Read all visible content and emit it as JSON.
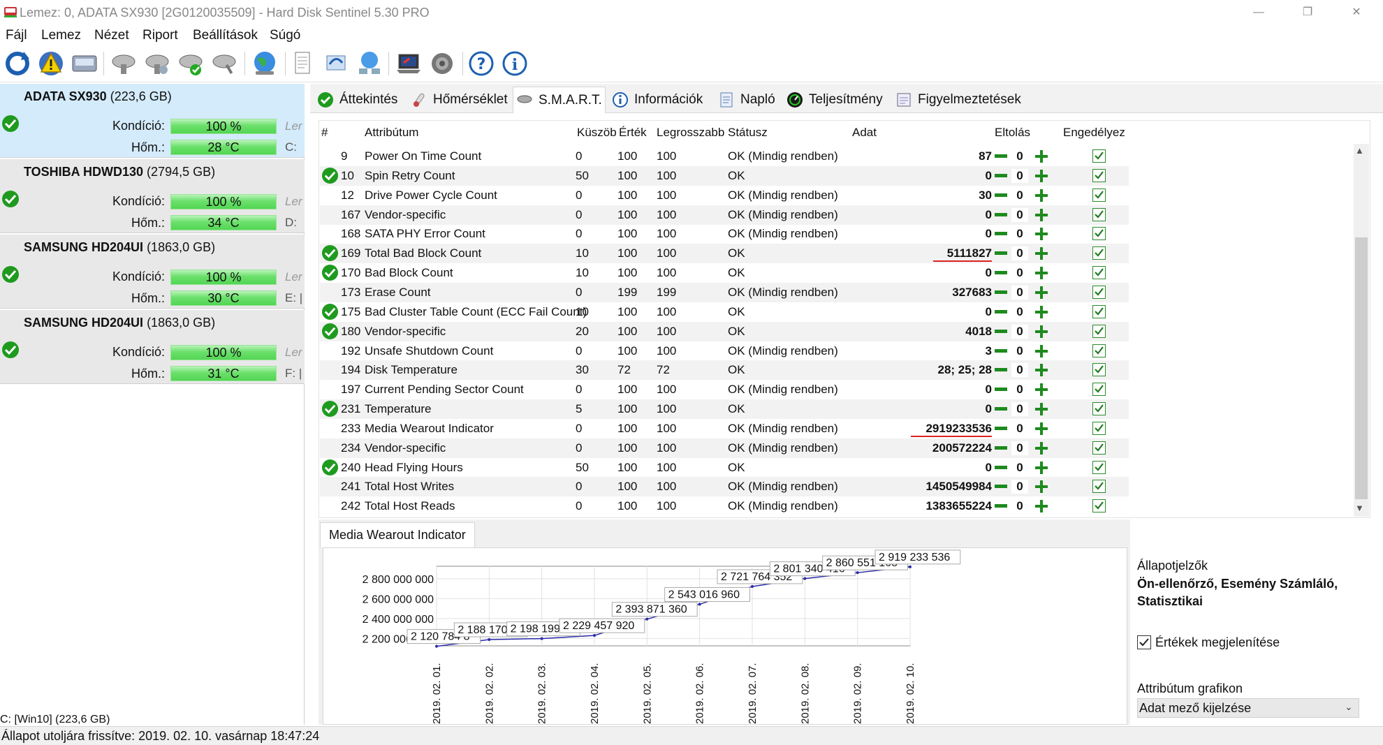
{
  "title": "Lemez: 0, ADATA SX930 [2G0120035509]  -  Hard Disk Sentinel 5.30 PRO",
  "window_buttons": [
    "—",
    "❐",
    "✕"
  ],
  "menu": [
    "Fájl",
    "Lemez",
    "Nézet",
    "Riport",
    "Beállítások",
    "Súgó"
  ],
  "toolbar_icons": [
    "refresh-icon",
    "warning-icon",
    "disk-icon",
    "disk-test-icon",
    "disk-test2-icon",
    "disk-ok-icon",
    "disk-tools-icon",
    "globe-icon",
    "report-icon",
    "sync-icon",
    "network-icon",
    "laptop-icon",
    "speaker-icon",
    "help-icon",
    "info-icon"
  ],
  "disks": [
    {
      "name": "ADATA SX930",
      "size": "(223,6 GB)",
      "health_label": "Kondíció:",
      "health": "100 %",
      "health_pct": 100,
      "temp_label": "Hőm.:",
      "temp": "28 °C",
      "trail1": "Ler",
      "trail2": "C:"
    },
    {
      "name": "TOSHIBA HDWD130",
      "size": "(2794,5 GB)",
      "health_label": "Kondíció:",
      "health": "100 %",
      "health_pct": 100,
      "temp_label": "Hőm.:",
      "temp": "34 °C",
      "trail1": "Ler",
      "trail2": "D:"
    },
    {
      "name": "SAMSUNG HD204UI",
      "size": "(1863,0 GB)",
      "health_label": "Kondíció:",
      "health": "100 %",
      "health_pct": 100,
      "temp_label": "Hőm.:",
      "temp": "30 °C",
      "trail1": "Ler",
      "trail2": "E: |"
    },
    {
      "name": "SAMSUNG HD204UI",
      "size": "(1863,0 GB)",
      "health_label": "Kondíció:",
      "health": "100 %",
      "health_pct": 100,
      "temp_label": "Hőm.:",
      "temp": "31 °C",
      "trail1": "Ler",
      "trail2": "F: |"
    }
  ],
  "left_bottom": "C: [Win10]                (223,6 GB)",
  "tabs": [
    "Áttekintés",
    "Hőmérséklet",
    "S.M.A.R.T.",
    "Információk",
    "Napló",
    "Teljesítmény",
    "Figyelmeztetések"
  ],
  "active_tab": 2,
  "columns": {
    "num": "#",
    "attr": "Attribútum",
    "threshold": "Küszöb",
    "value": "Érték",
    "worst": "Legrosszabb",
    "status": "Státusz",
    "data": "Adat",
    "offset": "Eltolás",
    "enable": "Engedélyez"
  },
  "smart_rows": [
    {
      "ok": false,
      "id": "9",
      "name": "Power On Time Count",
      "thr": "0",
      "val": "100",
      "worst": "100",
      "status": "OK (Mindig rendben)",
      "data": "87",
      "underline": false,
      "offset": "0",
      "enabled": true
    },
    {
      "ok": true,
      "id": "10",
      "name": "Spin Retry Count",
      "thr": "50",
      "val": "100",
      "worst": "100",
      "status": "OK",
      "data": "0",
      "underline": false,
      "offset": "0",
      "enabled": true
    },
    {
      "ok": false,
      "id": "12",
      "name": "Drive Power Cycle Count",
      "thr": "0",
      "val": "100",
      "worst": "100",
      "status": "OK (Mindig rendben)",
      "data": "30",
      "underline": false,
      "offset": "0",
      "enabled": true
    },
    {
      "ok": false,
      "id": "167",
      "name": "Vendor-specific",
      "thr": "0",
      "val": "100",
      "worst": "100",
      "status": "OK (Mindig rendben)",
      "data": "0",
      "underline": false,
      "offset": "0",
      "enabled": true
    },
    {
      "ok": false,
      "id": "168",
      "name": "SATA PHY Error Count",
      "thr": "0",
      "val": "100",
      "worst": "100",
      "status": "OK (Mindig rendben)",
      "data": "0",
      "underline": false,
      "offset": "0",
      "enabled": true
    },
    {
      "ok": true,
      "id": "169",
      "name": "Total Bad Block Count",
      "thr": "10",
      "val": "100",
      "worst": "100",
      "status": "OK",
      "data": "5111827",
      "underline": true,
      "offset": "0",
      "enabled": true
    },
    {
      "ok": true,
      "id": "170",
      "name": "Bad Block Count",
      "thr": "10",
      "val": "100",
      "worst": "100",
      "status": "OK",
      "data": "0",
      "underline": false,
      "offset": "0",
      "enabled": true
    },
    {
      "ok": false,
      "id": "173",
      "name": "Erase Count",
      "thr": "0",
      "val": "199",
      "worst": "199",
      "status": "OK (Mindig rendben)",
      "data": "327683",
      "underline": false,
      "offset": "0",
      "enabled": true
    },
    {
      "ok": true,
      "id": "175",
      "name": "Bad Cluster Table Count (ECC Fail Count)",
      "thr": "10",
      "val": "100",
      "worst": "100",
      "status": "OK",
      "data": "0",
      "underline": false,
      "offset": "0",
      "enabled": true
    },
    {
      "ok": true,
      "id": "180",
      "name": "Vendor-specific",
      "thr": "20",
      "val": "100",
      "worst": "100",
      "status": "OK",
      "data": "4018",
      "underline": false,
      "offset": "0",
      "enabled": true
    },
    {
      "ok": false,
      "id": "192",
      "name": "Unsafe Shutdown Count",
      "thr": "0",
      "val": "100",
      "worst": "100",
      "status": "OK (Mindig rendben)",
      "data": "3",
      "underline": false,
      "offset": "0",
      "enabled": true
    },
    {
      "ok": false,
      "id": "194",
      "name": "Disk Temperature",
      "thr": "30",
      "val": "72",
      "worst": "72",
      "status": "OK",
      "data": "28; 25; 28",
      "underline": false,
      "offset": "0",
      "enabled": true
    },
    {
      "ok": false,
      "id": "197",
      "name": "Current Pending Sector Count",
      "thr": "0",
      "val": "100",
      "worst": "100",
      "status": "OK (Mindig rendben)",
      "data": "0",
      "underline": false,
      "offset": "0",
      "enabled": true
    },
    {
      "ok": true,
      "id": "231",
      "name": "Temperature",
      "thr": "5",
      "val": "100",
      "worst": "100",
      "status": "OK",
      "data": "0",
      "underline": false,
      "offset": "0",
      "enabled": true
    },
    {
      "ok": false,
      "id": "233",
      "name": "Media Wearout Indicator",
      "thr": "0",
      "val": "100",
      "worst": "100",
      "status": "OK (Mindig rendben)",
      "data": "2919233536",
      "underline": true,
      "offset": "0",
      "enabled": true
    },
    {
      "ok": false,
      "id": "234",
      "name": "Vendor-specific",
      "thr": "0",
      "val": "100",
      "worst": "100",
      "status": "OK (Mindig rendben)",
      "data": "200572224",
      "underline": false,
      "offset": "0",
      "enabled": true
    },
    {
      "ok": true,
      "id": "240",
      "name": "Head Flying Hours",
      "thr": "50",
      "val": "100",
      "worst": "100",
      "status": "OK",
      "data": "0",
      "underline": false,
      "offset": "0",
      "enabled": true
    },
    {
      "ok": false,
      "id": "241",
      "name": "Total Host Writes",
      "thr": "0",
      "val": "100",
      "worst": "100",
      "status": "OK (Mindig rendben)",
      "data": "1450549984",
      "underline": false,
      "offset": "0",
      "enabled": true
    },
    {
      "ok": false,
      "id": "242",
      "name": "Total Host Reads",
      "thr": "0",
      "val": "100",
      "worst": "100",
      "status": "OK (Mindig rendben)",
      "data": "1383655224",
      "underline": false,
      "offset": "0",
      "enabled": true
    }
  ],
  "chart_tab": "Media Wearout Indicator",
  "chart_data": {
    "type": "line",
    "title": "",
    "xlabel": "",
    "ylabel": "",
    "x": [
      "2019. 02. 01.",
      "2019. 02. 02.",
      "2019. 02. 03.",
      "2019. 02. 04.",
      "2019. 02. 05.",
      "2019. 02. 06.",
      "2019. 02. 07.",
      "2019. 02. 08.",
      "2019. 02. 09.",
      "2019. 02. 10."
    ],
    "values": [
      2120784800,
      2188170200,
      2198199200,
      2229457920,
      2393871360,
      2543016960,
      2721764352,
      2801340416,
      2860551168,
      2919233536
    ],
    "data_labels": [
      "2 120 784 8",
      "2 188 170 2",
      "2 198 199 2",
      "2 229 457 920",
      "2 393 871 360",
      "2 543 016 960",
      "2 721 764 352",
      "2 801 340 416",
      "2 860 551 168",
      "2 919 233 536"
    ],
    "yticks": [
      "2 200 000 000",
      "2 400 000 000",
      "2 600 000 000",
      "2 800 000 000"
    ],
    "ytick_values": [
      2200000000,
      2400000000,
      2600000000,
      2800000000
    ],
    "ylim": [
      2125000000,
      2925000000
    ],
    "grid": true,
    "line_color": "#2a2aaa"
  },
  "options": {
    "indicators_title": "Állapotjelzők",
    "indicators_value": "Ön-ellenőrző, Esemény Számláló, Statisztikai",
    "show_values_label": "Értékek megjelenítése",
    "show_values_checked": true,
    "graph_label": "Attribútum grafikon",
    "graph_select": "Adat mező kijelzése"
  },
  "status_bar": "Állapot utoljára frissítve: 2019. 02. 10. vasárnap 18:47:24",
  "colors": {
    "ok_green": "#1f9a1f",
    "bar_green": "#6be06b",
    "selected_disk": "#d4ebfb",
    "underline_red": "#d22222",
    "plus_green": "#1e8a1e"
  }
}
